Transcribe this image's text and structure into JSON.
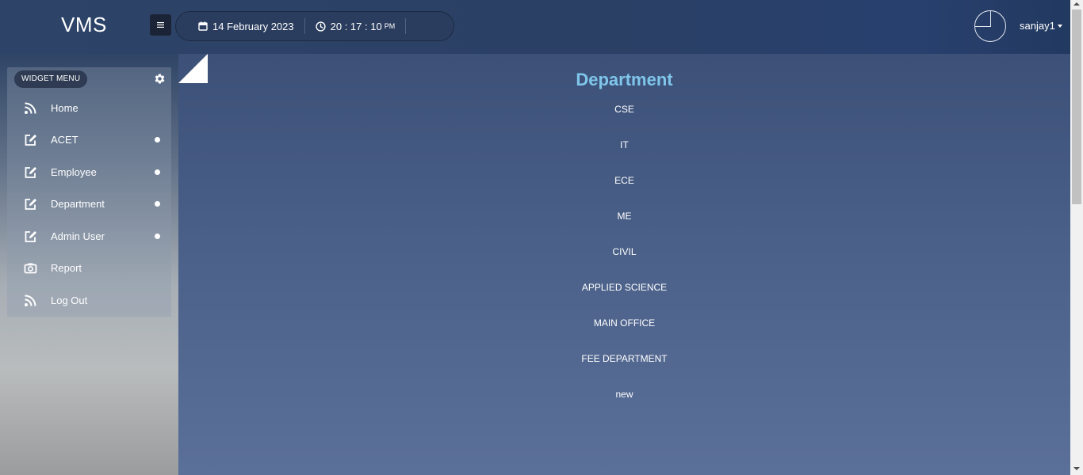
{
  "app": {
    "title": "VMS"
  },
  "header": {
    "date": "14 February 2023",
    "time": "20 : 17 : 10",
    "ampm": "PM",
    "username": "sanjay1"
  },
  "sidebar": {
    "widget_label": "WIDGET MENU",
    "items": [
      {
        "label": "Home",
        "icon": "rss-icon",
        "has_dot": false
      },
      {
        "label": "ACET",
        "icon": "edit-icon",
        "has_dot": true
      },
      {
        "label": "Employee",
        "icon": "edit-icon",
        "has_dot": true
      },
      {
        "label": "Department",
        "icon": "edit-icon",
        "has_dot": true
      },
      {
        "label": "Admin User",
        "icon": "edit-icon",
        "has_dot": true
      },
      {
        "label": "Report",
        "icon": "camera-icon",
        "has_dot": false
      },
      {
        "label": "Log Out",
        "icon": "rss-icon",
        "has_dot": false
      }
    ]
  },
  "main": {
    "title": "Department",
    "departments": [
      "CSE",
      "IT",
      "ECE",
      "ME",
      "CIVIL",
      "APPLIED SCIENCE",
      "MAIN OFFICE",
      "FEE DEPARTMENT",
      "new"
    ]
  },
  "colors": {
    "title_accent": "#7fc6ea",
    "header_bg": "#2d4468",
    "main_bg": "#4a6088"
  }
}
